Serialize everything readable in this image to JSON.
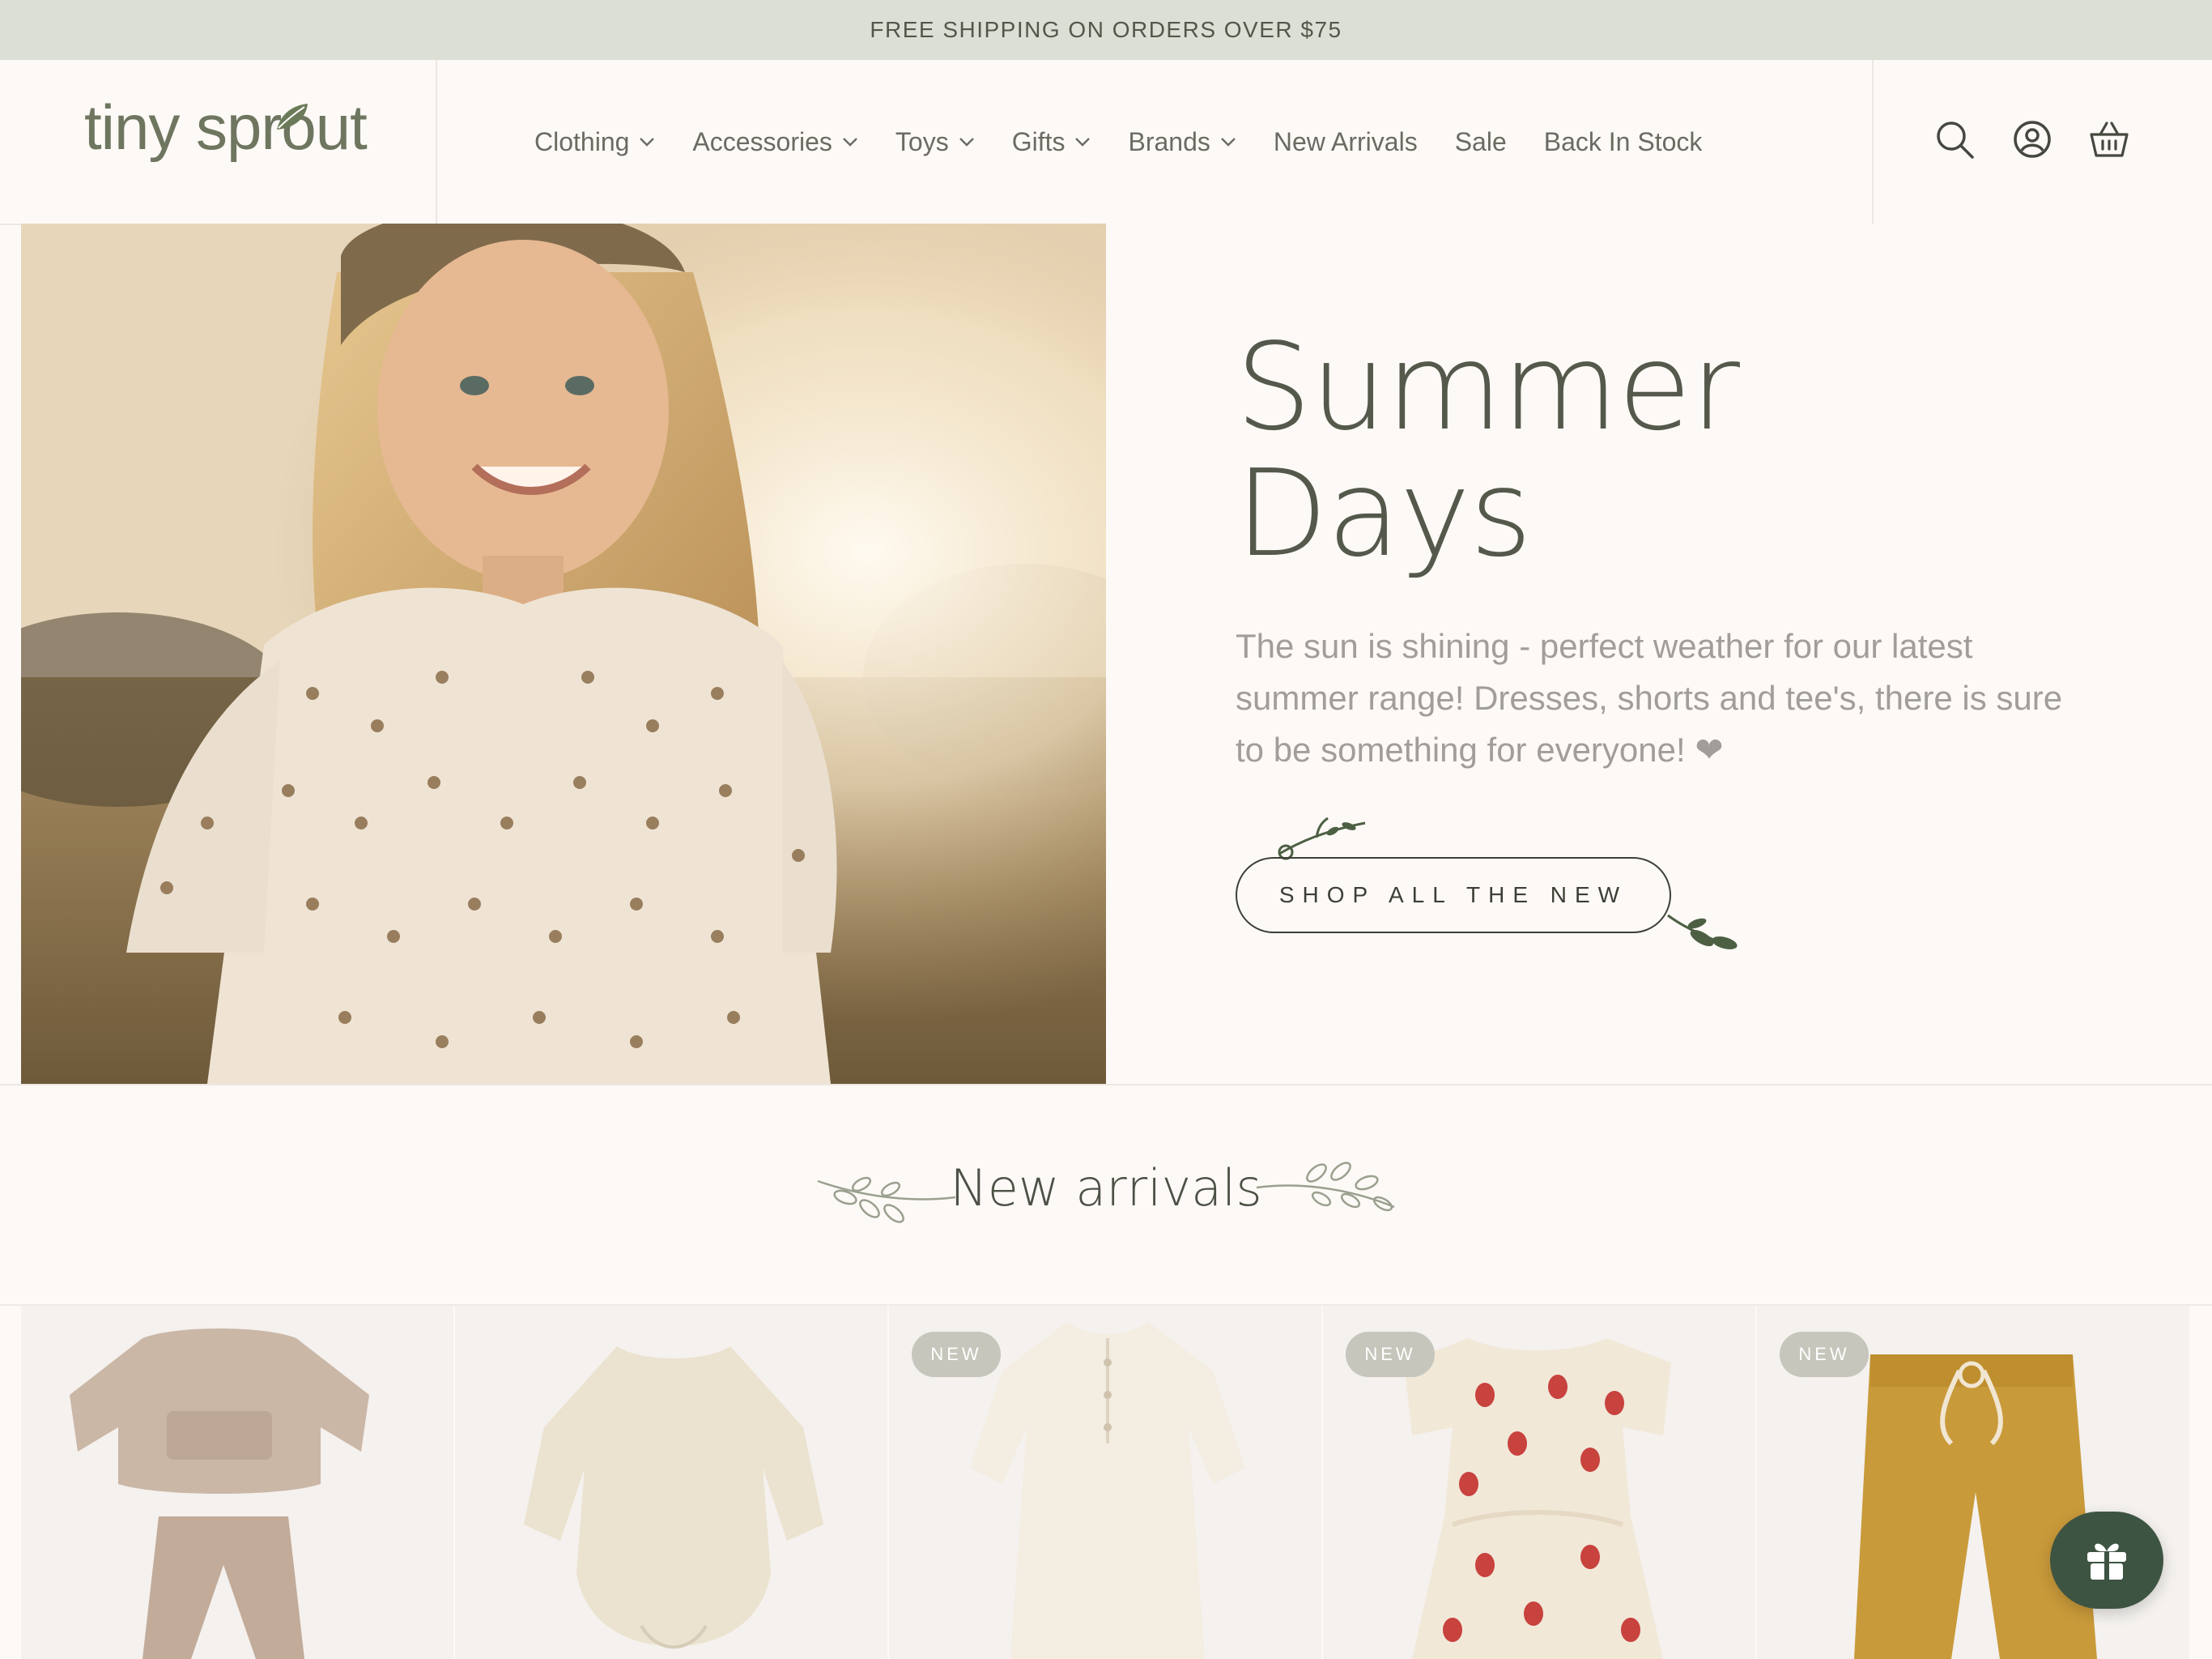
{
  "announcement": "FREE SHIPPING ON ORDERS OVER $75",
  "brand": {
    "logo_text": "tiny sprout"
  },
  "nav": [
    {
      "label": "Clothing",
      "has_dropdown": true
    },
    {
      "label": "Accessories",
      "has_dropdown": true
    },
    {
      "label": "Toys",
      "has_dropdown": true
    },
    {
      "label": "Gifts",
      "has_dropdown": true
    },
    {
      "label": "Brands",
      "has_dropdown": true
    },
    {
      "label": "New Arrivals",
      "has_dropdown": false
    },
    {
      "label": "Sale",
      "has_dropdown": false
    },
    {
      "label": "Back In Stock",
      "has_dropdown": false
    }
  ],
  "header_icons": [
    "search-icon",
    "account-icon",
    "basket-icon"
  ],
  "hero": {
    "title_line1": "Summer",
    "title_line2": "Days",
    "description": "The sun is shining - perfect weather for our latest summer range! Dresses, shorts and tee's, there is sure to be something for everyone! ❤",
    "cta": "SHOP ALL THE NEW"
  },
  "new_arrivals": {
    "title": "New arrivals",
    "products": [
      {
        "badge": "",
        "icon": "sweater-set-icon",
        "color": "#cbb7a6"
      },
      {
        "badge": "",
        "icon": "romper-icon",
        "color": "#ebe2cf"
      },
      {
        "badge": "NEW",
        "icon": "sleep-gown-icon",
        "color": "#f3ede2"
      },
      {
        "badge": "NEW",
        "icon": "strawberry-dress-icon",
        "color": "#f1e8d8"
      },
      {
        "badge": "NEW",
        "icon": "pants-icon",
        "color": "#c99a3a"
      }
    ]
  },
  "colors": {
    "accent": "#3e5443",
    "announcement_bg": "#dcdfd5",
    "background": "#fdf9f6"
  }
}
